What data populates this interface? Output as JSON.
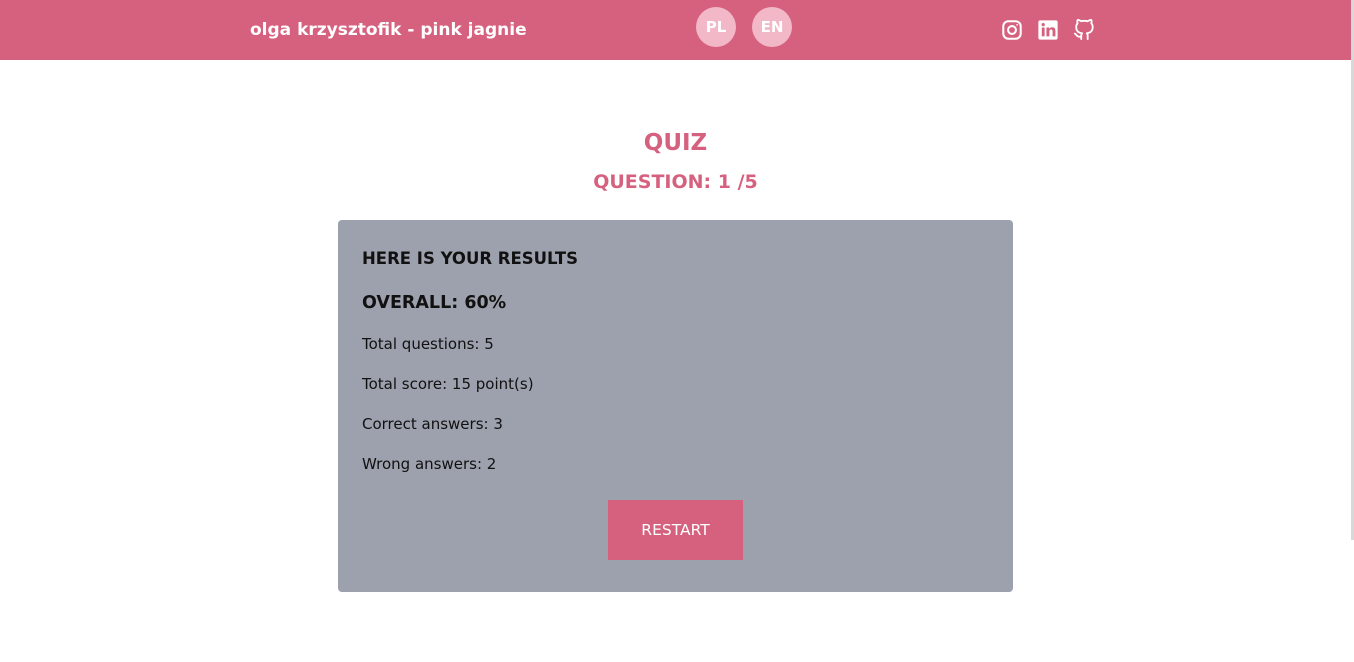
{
  "header": {
    "brand": "olga krzysztofik - pink jagnie",
    "languages": [
      {
        "label": "PL"
      },
      {
        "label": "EN"
      }
    ],
    "social_icons": [
      "instagram-icon",
      "linkedin-icon",
      "github-icon"
    ]
  },
  "quiz": {
    "title": "QUIZ",
    "question_counter": "QUESTION: 1 /5"
  },
  "results": {
    "heading": "HERE IS YOUR RESULTS",
    "overall": "OVERALL: 60%",
    "stats": [
      "Total questions: 5",
      "Total score: 15 point(s)",
      "Correct answers: 3",
      "Wrong answers: 2"
    ],
    "restart_label": "RESTART"
  },
  "colors": {
    "accent": "#d6617f",
    "lang_badge": "#f2b8c8",
    "card_background": "#9ca1ad",
    "page_background": "#ffffff"
  }
}
